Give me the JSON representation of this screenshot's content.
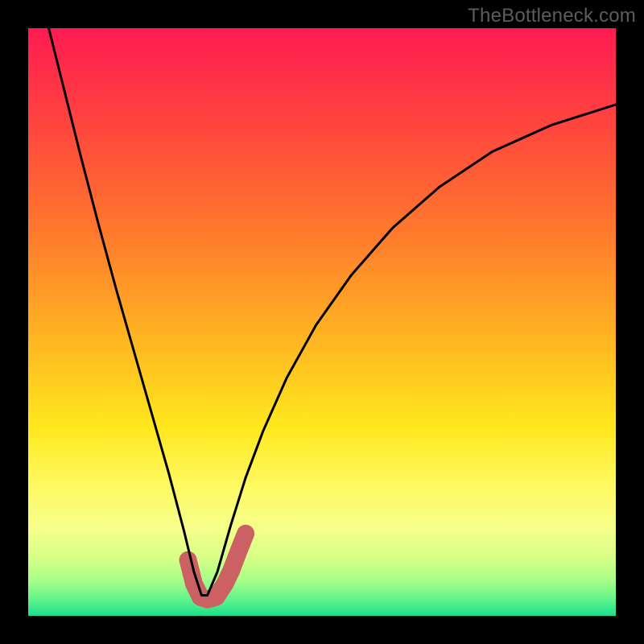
{
  "watermark": "TheBottleneck.com",
  "chart_data": {
    "type": "line",
    "title": "",
    "xlabel": "",
    "ylabel": "",
    "xlim": [
      0,
      1
    ],
    "ylim": [
      0,
      1
    ],
    "background_gradient": {
      "stops": [
        {
          "t": 0.0,
          "color": "#ff1b52"
        },
        {
          "t": 0.18,
          "color": "#ff493c"
        },
        {
          "t": 0.35,
          "color": "#ff7a2c"
        },
        {
          "t": 0.52,
          "color": "#ffb222"
        },
        {
          "t": 0.68,
          "color": "#ffe81e"
        },
        {
          "t": 0.78,
          "color": "#fff963"
        },
        {
          "t": 0.85,
          "color": "#f6ff8a"
        },
        {
          "t": 0.9,
          "color": "#d8ff87"
        },
        {
          "t": 0.94,
          "color": "#a6ff87"
        },
        {
          "t": 0.97,
          "color": "#66f58a"
        },
        {
          "t": 1.0,
          "color": "#19e08e"
        }
      ]
    },
    "series": [
      {
        "name": "bottleneck-curve",
        "type": "line",
        "color": "#000000",
        "stroke_width": 3,
        "x": [
          0.035,
          0.06,
          0.09,
          0.12,
          0.15,
          0.18,
          0.21,
          0.24,
          0.265,
          0.282,
          0.295,
          0.305,
          0.322,
          0.345,
          0.37,
          0.4,
          0.44,
          0.49,
          0.55,
          0.62,
          0.7,
          0.79,
          0.89,
          1.0
        ],
        "y": [
          1.0,
          0.9,
          0.78,
          0.665,
          0.555,
          0.45,
          0.345,
          0.24,
          0.145,
          0.075,
          0.035,
          0.035,
          0.075,
          0.155,
          0.235,
          0.315,
          0.405,
          0.495,
          0.58,
          0.66,
          0.73,
          0.79,
          0.835,
          0.87
        ]
      },
      {
        "name": "highlight-region",
        "type": "line",
        "color": "#cc6163",
        "stroke_width": 22,
        "stroke_linecap": "round",
        "x": [
          0.272,
          0.282,
          0.293,
          0.305,
          0.32,
          0.335,
          0.345,
          0.36,
          0.37
        ],
        "y": [
          0.095,
          0.055,
          0.032,
          0.028,
          0.032,
          0.055,
          0.076,
          0.115,
          0.14
        ]
      }
    ]
  }
}
